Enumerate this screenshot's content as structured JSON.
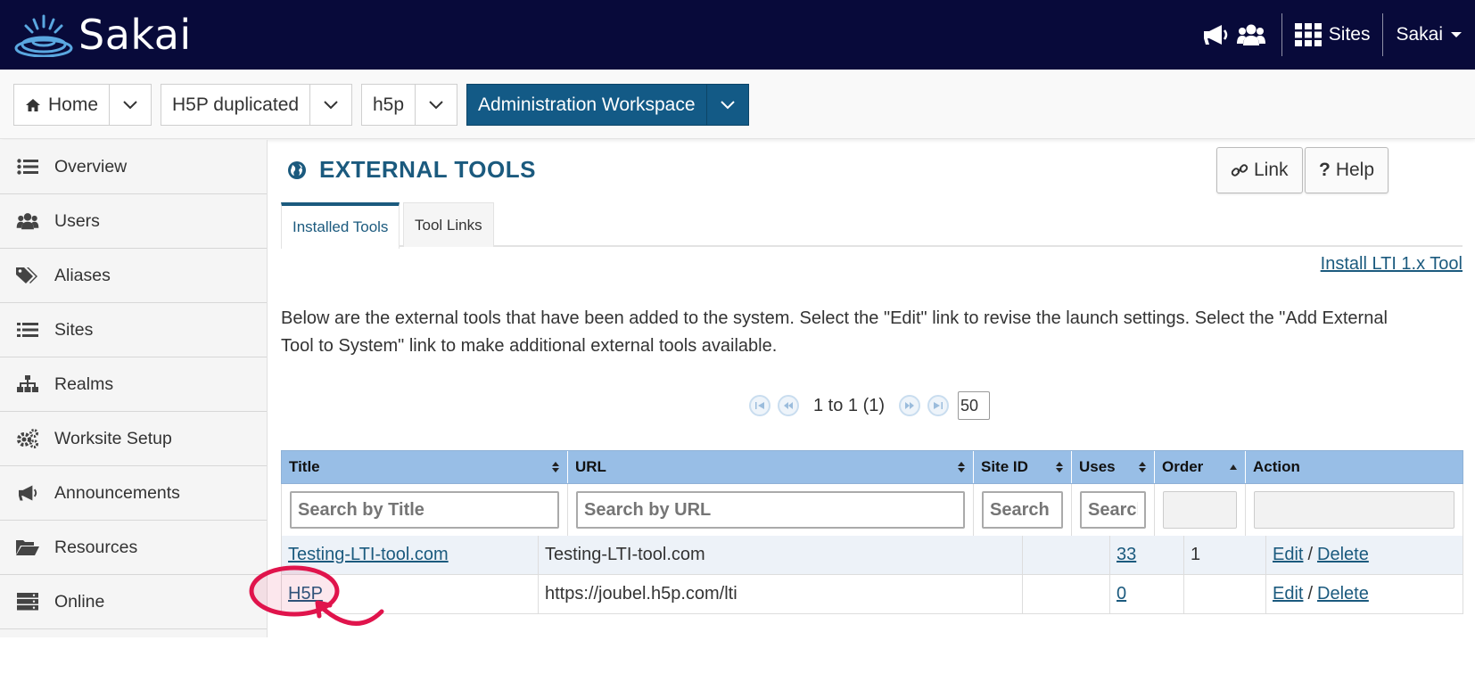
{
  "header": {
    "brand": "Sakai",
    "sites_label": "Sites",
    "user_label": "Sakai",
    "icons": [
      "sakai-logo-icon",
      "megaphone-icon",
      "users-icon",
      "grid-icon",
      "caret-down-icon"
    ]
  },
  "sitenav": {
    "items": [
      {
        "label": "Home",
        "icon": "home-icon"
      },
      {
        "label": "H5P duplicated"
      },
      {
        "label": "h5p"
      },
      {
        "label": "Administration Workspace",
        "active": true
      }
    ]
  },
  "sidebar": {
    "items": [
      {
        "label": "Overview",
        "icon": "list-icon"
      },
      {
        "label": "Users",
        "icon": "users-icon"
      },
      {
        "label": "Aliases",
        "icon": "tags-icon"
      },
      {
        "label": "Sites",
        "icon": "list-icon"
      },
      {
        "label": "Realms",
        "icon": "sitemap-icon"
      },
      {
        "label": "Worksite Setup",
        "icon": "gears-icon"
      },
      {
        "label": "Announcements",
        "icon": "megaphone-icon"
      },
      {
        "label": "Resources",
        "icon": "folder-open-icon"
      },
      {
        "label": "Online",
        "icon": "server-icon"
      }
    ]
  },
  "main": {
    "title": "EXTERNAL TOOLS",
    "link_button": "Link",
    "help_button": "Help",
    "tabs": [
      {
        "label": "Installed Tools",
        "active": true
      },
      {
        "label": "Tool Links"
      }
    ],
    "install_link": "Install LTI 1.x Tool",
    "description": "Below are the external tools that have been added to the system. Select the \"Edit\" link to revise the launch settings. Select the \"Add External Tool to System\" link to make additional external tools available.",
    "pager": {
      "range": "1 to 1 (1)",
      "page_size": "50"
    }
  },
  "table": {
    "columns": [
      "Title",
      "URL",
      "Site ID",
      "Uses",
      "Order",
      "Action"
    ],
    "filters": {
      "title": "Search by Title",
      "url": "Search by URL",
      "site_id": "Search by Site ID",
      "uses": "Search by Uses"
    },
    "rows": [
      {
        "title": "Testing-LTI-tool.com",
        "url": "Testing-LTI-tool.com",
        "site_id": "",
        "uses": "33",
        "order": "1",
        "edit": "Edit",
        "delete": "Delete"
      },
      {
        "title": "H5P",
        "url": "https://joubel.h5p.com/lti",
        "site_id": "",
        "uses": "0",
        "order": "",
        "edit": "Edit",
        "delete": "Delete"
      }
    ],
    "action_separator": "/"
  },
  "colors": {
    "header_bg": "#080a3a",
    "active_nav": "#135a86",
    "title_color": "#1b5a7e",
    "table_header": "#98bee6",
    "highlight": "#e0144c"
  }
}
